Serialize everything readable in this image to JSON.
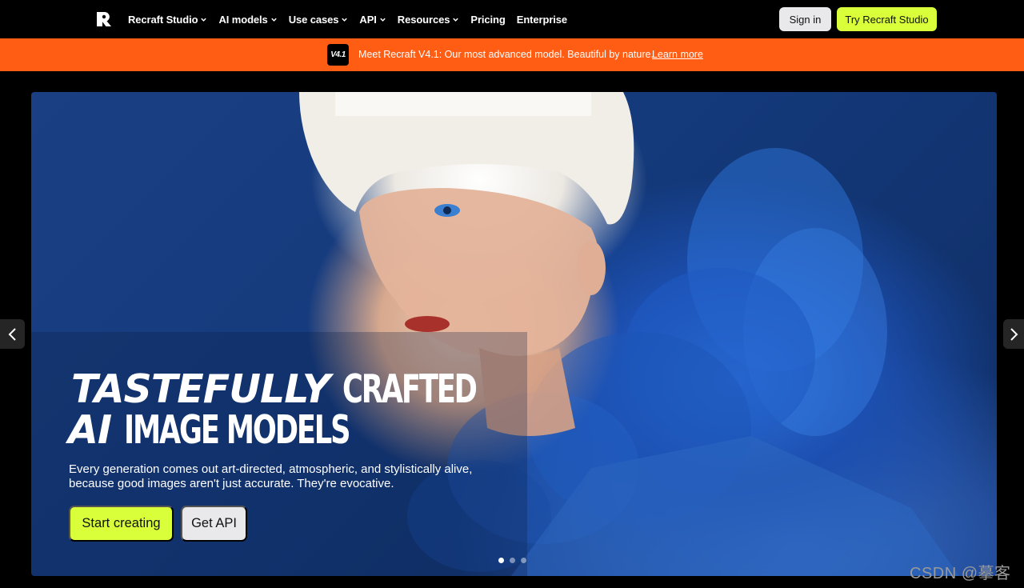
{
  "brand": {
    "logo_icon": "recraft-logo-icon"
  },
  "nav": {
    "items": [
      {
        "label": "Recraft Studio",
        "has_dropdown": true
      },
      {
        "label": "AI models",
        "has_dropdown": true
      },
      {
        "label": "Use cases",
        "has_dropdown": true
      },
      {
        "label": "API",
        "has_dropdown": true
      },
      {
        "label": "Resources",
        "has_dropdown": true
      },
      {
        "label": "Pricing",
        "has_dropdown": false
      },
      {
        "label": "Enterprise",
        "has_dropdown": false
      }
    ],
    "signin_label": "Sign in",
    "try_label": "Try Recraft Studio"
  },
  "banner": {
    "badge": "V4.1",
    "text": "Meet Recraft V4.1: Our most advanced model. Beautiful by nature.",
    "link_label": "Learn more"
  },
  "hero": {
    "headline_line1_bold": "TASTEFULLY",
    "headline_line1_thin": "CRAFTED",
    "headline_line2_bold": "AI",
    "headline_line2_thin": "IMAGE MODELS",
    "subtext": "Every generation comes out art-directed, atmospheric, and stylistically alive, because good images aren't just accurate. They're evocative.",
    "primary_cta": "Start creating",
    "secondary_cta": "Get API",
    "slides_total": 3,
    "active_slide": 1
  },
  "watermark": "CSDN @摹客",
  "colors": {
    "accent_lime": "#d8ff3a",
    "banner_orange": "#ff5c14",
    "background": "#000000",
    "button_light": "#e9e9ec"
  }
}
